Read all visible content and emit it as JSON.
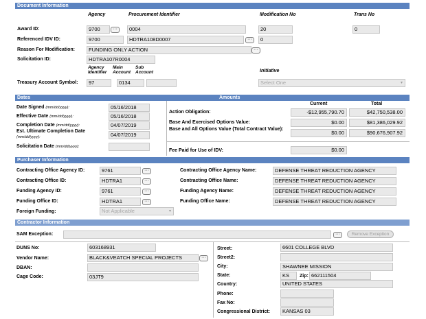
{
  "sections": {
    "document_information": "Document Information",
    "dates": "Dates",
    "amounts": "Amounts",
    "purchaser_information": "Purchaser Information",
    "contractor_information": "Contractor Information"
  },
  "doc": {
    "col_agency": "Agency",
    "col_procurement": "Procurement Identifier",
    "col_modification": "Modification No",
    "col_trans": "Trans No",
    "award_id_label": "Award ID:",
    "award_agency": "9700",
    "award_procurement": "0004",
    "award_modification": "20",
    "award_trans": "0",
    "ref_idv_label": "Referenced IDV ID:",
    "ref_agency": "9700",
    "ref_procurement": "HDTRA108D0007",
    "ref_modification": "0",
    "reason_label": "Reason For Modification:",
    "reason_value": "FUNDING ONLY ACTION",
    "solicitation_label": "Solicitation ID:",
    "solicitation_value": "HDTRA107R0004",
    "tas_col1": "Agency Identifier",
    "tas_col2": "Main Account",
    "tas_col3": "Sub Account",
    "tas_label": "Treasury Account Symbol:",
    "tas_agency": "97",
    "tas_main": "0134",
    "tas_sub": "",
    "initiative_label": "Initiative",
    "initiative_value": "Select One"
  },
  "dates": {
    "signed_label": "Date Signed",
    "signed_fmt": "(mm/dd/yyyy):",
    "signed_value": "05/16/2018",
    "effective_label": "Effective Date",
    "effective_fmt": "(mm/dd/yyyy):",
    "effective_value": "05/16/2018",
    "completion_label": "Completion Date",
    "completion_fmt": "(mm/dd/yyyy):",
    "completion_value": "04/07/2019",
    "est_label": "Est. Ultimate Completion Date",
    "est_fmt": "(mm/dd/yyyy):",
    "est_value": "04/07/2019",
    "solicitation_label": "Solicitation Date",
    "solicitation_fmt": "(mm/dd/yyyy):",
    "solicitation_value": ""
  },
  "amounts": {
    "col_current": "Current",
    "col_total": "Total",
    "obligation_label": "Action Obligation:",
    "obligation_current": "-$12,955,790.70",
    "obligation_total": "$42,750,538.00",
    "base_exercised_label": "Base And Exercised Options Value:",
    "base_exercised_current": "$0.00",
    "base_exercised_total": "$81,386,029.92",
    "base_all_label": "Base and All Options Value (Total Contract Value):",
    "base_all_current": "$0.00",
    "base_all_total": "$90,676,907.92",
    "fee_label": "Fee Paid for Use of IDV:",
    "fee_value": "$0.00"
  },
  "purchaser": {
    "co_agency_id_label": "Contracting Office Agency ID:",
    "co_agency_id": "9761",
    "co_id_label": "Contracting Office ID:",
    "co_id": "HDTRA1",
    "funding_agency_id_label": "Funding Agency ID:",
    "funding_agency_id": "9761",
    "funding_office_id_label": "Funding Office ID:",
    "funding_office_id": "HDTRA1",
    "foreign_funding_label": "Foreign Funding:",
    "foreign_funding": "Not Applicable",
    "co_agency_name_label": "Contracting Office Agency Name:",
    "co_agency_name": "DEFENSE THREAT REDUCTION AGENCY",
    "co_name_label": "Contracting Office Name:",
    "co_name": "DEFENSE THREAT REDUCTION AGENCY",
    "funding_agency_name_label": "Funding Agency Name:",
    "funding_agency_name": "DEFENSE THREAT REDUCTION AGENCY",
    "funding_office_name_label": "Funding Office Name:",
    "funding_office_name": "DEFENSE THREAT REDUCTION AGENCY"
  },
  "contractor": {
    "sam_label": "SAM Exception:",
    "sam_value": "",
    "remove_exception": "Remove Exception",
    "duns_label": "DUNS No:",
    "duns": "603168931",
    "vendor_label": "Vendor Name:",
    "vendor": "BLACK&VEATCH SPECIAL PROJECTS",
    "dban_label": "DBAN:",
    "dban": "",
    "cage_label": "Cage Code:",
    "cage": "03JT9",
    "street_label": "Street:",
    "street": "6601 COLLEGE BLVD",
    "street2_label": "Street2:",
    "street2": "",
    "city_label": "City:",
    "city": "SHAWNEE MISSION",
    "state_label": "State:",
    "state": "KS",
    "zip_label": "Zip:",
    "zip": "662111504",
    "country_label": "Country:",
    "country": "UNITED STATES",
    "phone_label": "Phone:",
    "phone": "",
    "fax_label": "Fax No:",
    "fax": "",
    "district_label": "Congressional District:",
    "district": "KANSAS 03"
  },
  "icons": {
    "lookup": "ellipsis-button-icon",
    "dropdown": "chevron-down-icon"
  },
  "colors": {
    "section_header": "#5b83c0",
    "field_bg": "#e9e9e9"
  }
}
